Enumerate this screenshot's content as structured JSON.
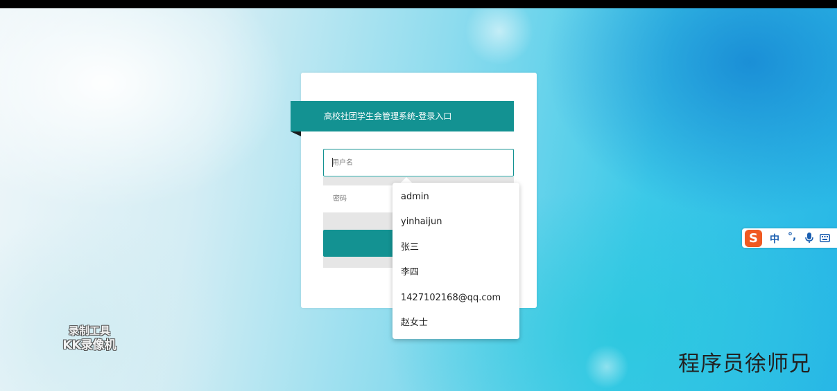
{
  "login": {
    "title": "高校社团学生会管理系统-登录入口",
    "username_placeholder": "用户名",
    "password_placeholder": "密码",
    "login_button_label": ""
  },
  "autocomplete": {
    "suggestions": [
      "admin",
      "yinhaijun",
      "张三",
      "李四",
      "1427102168@qq.com",
      "赵女士"
    ]
  },
  "ime_toolbar": {
    "logo_icon": "sogou-logo-icon",
    "logo_text": "S",
    "language": "中",
    "punctuation": "°,",
    "mic_icon": "microphone-icon",
    "keyboard_icon": "keyboard-icon"
  },
  "watermarks": {
    "recorder_line1": "录制工具",
    "recorder_line2": "KK录像机",
    "author": "程序员徐师兄"
  },
  "colors": {
    "accent": "#139292",
    "ime_blue": "#1a5eb0",
    "ime_logo": "#f05a22"
  }
}
